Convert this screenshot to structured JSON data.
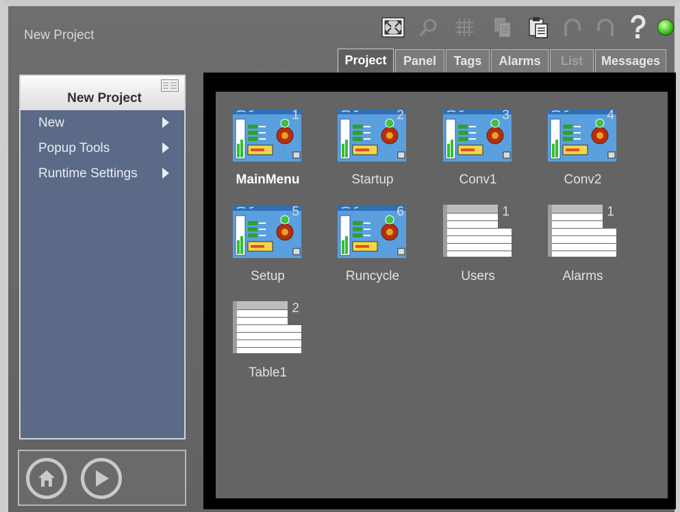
{
  "app": {
    "title": "New Project"
  },
  "toolbar": {
    "icons": [
      "fullscreen-icon",
      "zoom-icon",
      "grid-icon",
      "copy-icon",
      "paste-icon",
      "undo-icon",
      "redo-icon",
      "help-icon",
      "status-led-icon"
    ],
    "status_color": "#3ec81a"
  },
  "tabs": [
    {
      "label": "Project",
      "state": "active"
    },
    {
      "label": "Panel",
      "state": "normal"
    },
    {
      "label": "Tags",
      "state": "normal"
    },
    {
      "label": "Alarms",
      "state": "normal"
    },
    {
      "label": "List",
      "state": "disabled"
    },
    {
      "label": "Messages",
      "state": "normal"
    }
  ],
  "sidebar": {
    "title": "New Project",
    "items": [
      {
        "label": "New"
      },
      {
        "label": "Popup Tools"
      },
      {
        "label": "Runtime Settings"
      }
    ]
  },
  "bottom_buttons": [
    {
      "name": "home-icon"
    },
    {
      "name": "play-icon"
    }
  ],
  "panels": [
    {
      "label": "MainMenu",
      "number": "1",
      "kind": "panel",
      "selected": true
    },
    {
      "label": "Startup",
      "number": "2",
      "kind": "panel",
      "selected": false
    },
    {
      "label": "Conv1",
      "number": "3",
      "kind": "panel",
      "selected": false
    },
    {
      "label": "Conv2",
      "number": "4",
      "kind": "panel",
      "selected": false
    },
    {
      "label": "Setup",
      "number": "5",
      "kind": "panel",
      "selected": false
    },
    {
      "label": "Runcycle",
      "number": "6",
      "kind": "panel",
      "selected": false
    },
    {
      "label": "Users",
      "number": "1",
      "kind": "table",
      "selected": false
    },
    {
      "label": "Alarms",
      "number": "1",
      "kind": "table",
      "selected": false
    },
    {
      "label": "Table1",
      "number": "2",
      "kind": "table",
      "selected": false
    }
  ],
  "colors": {
    "background": "#646464",
    "sidebar": "#5b6a86",
    "thumbnail_blue": "#5aa0df"
  }
}
